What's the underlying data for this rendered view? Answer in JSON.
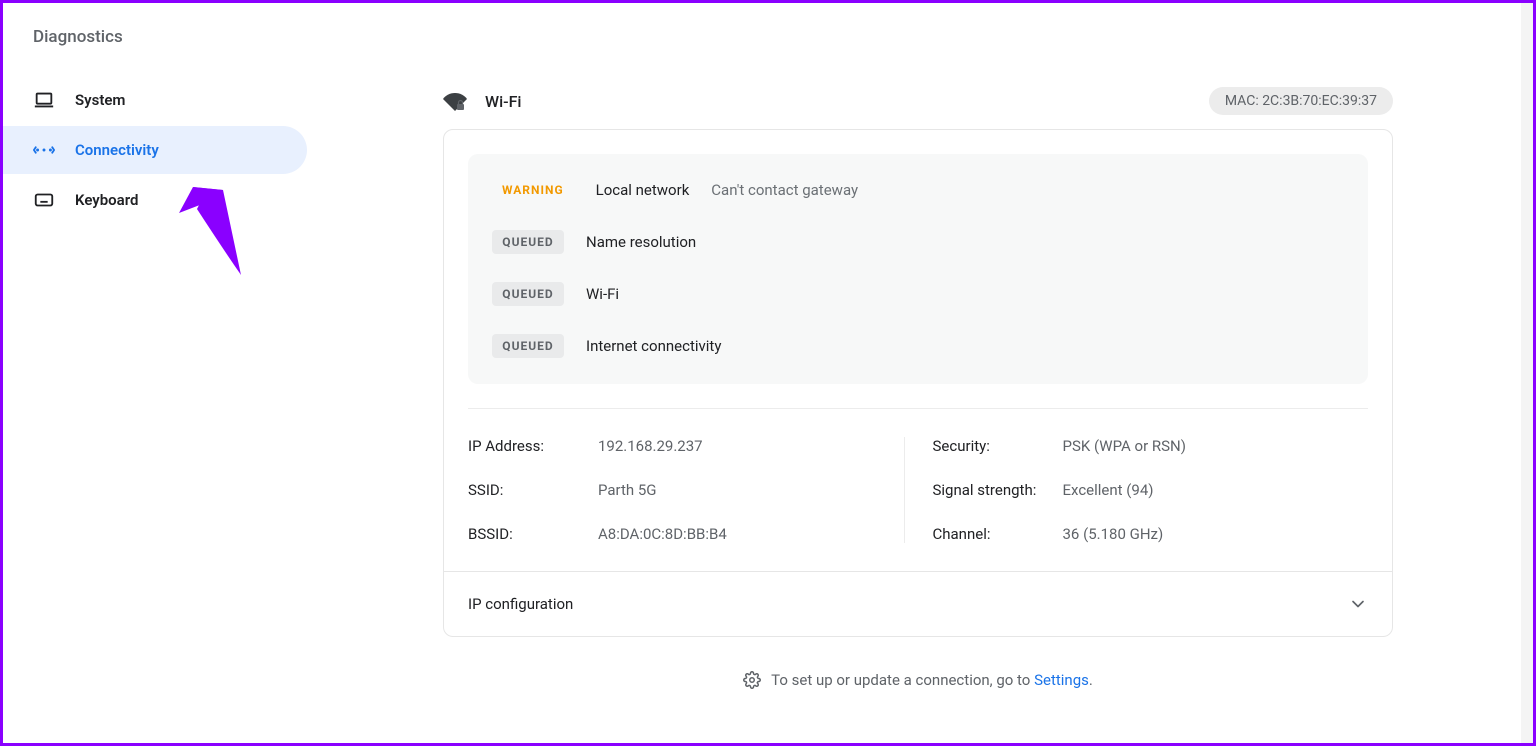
{
  "app_title": "Diagnostics",
  "sidebar": {
    "items": [
      {
        "id": "system",
        "label": "System",
        "icon": "laptop-icon",
        "active": false
      },
      {
        "id": "connectivity",
        "label": "Connectivity",
        "icon": "transfer-icon",
        "active": true
      },
      {
        "id": "keyboard",
        "label": "Keyboard",
        "icon": "keyboard-icon",
        "active": false
      }
    ]
  },
  "header": {
    "title": "Wi-Fi",
    "mac_label": "MAC: 2C:3B:70:EC:39:37"
  },
  "tests": [
    {
      "badge": "WARNING",
      "badge_kind": "warn",
      "name": "Local network",
      "detail": "Can't contact gateway"
    },
    {
      "badge": "QUEUED",
      "badge_kind": "queued",
      "name": "Name resolution",
      "detail": ""
    },
    {
      "badge": "QUEUED",
      "badge_kind": "queued",
      "name": "Wi-Fi",
      "detail": ""
    },
    {
      "badge": "QUEUED",
      "badge_kind": "queued",
      "name": "Internet connectivity",
      "detail": ""
    }
  ],
  "details": {
    "left": [
      {
        "k": "IP Address:",
        "v": "192.168.29.237"
      },
      {
        "k": "SSID:",
        "v": "Parth 5G"
      },
      {
        "k": "BSSID:",
        "v": "A8:DA:0C:8D:BB:B4"
      }
    ],
    "right": [
      {
        "k": "Security:",
        "v": "PSK (WPA or RSN)"
      },
      {
        "k": "Signal strength:",
        "v": "Excellent (94)"
      },
      {
        "k": "Channel:",
        "v": "36 (5.180 GHz)"
      }
    ]
  },
  "ip_config_label": "IP configuration",
  "footer": {
    "text_prefix": "To set up or update a connection, go to ",
    "link_text": "Settings",
    "text_suffix": "."
  }
}
